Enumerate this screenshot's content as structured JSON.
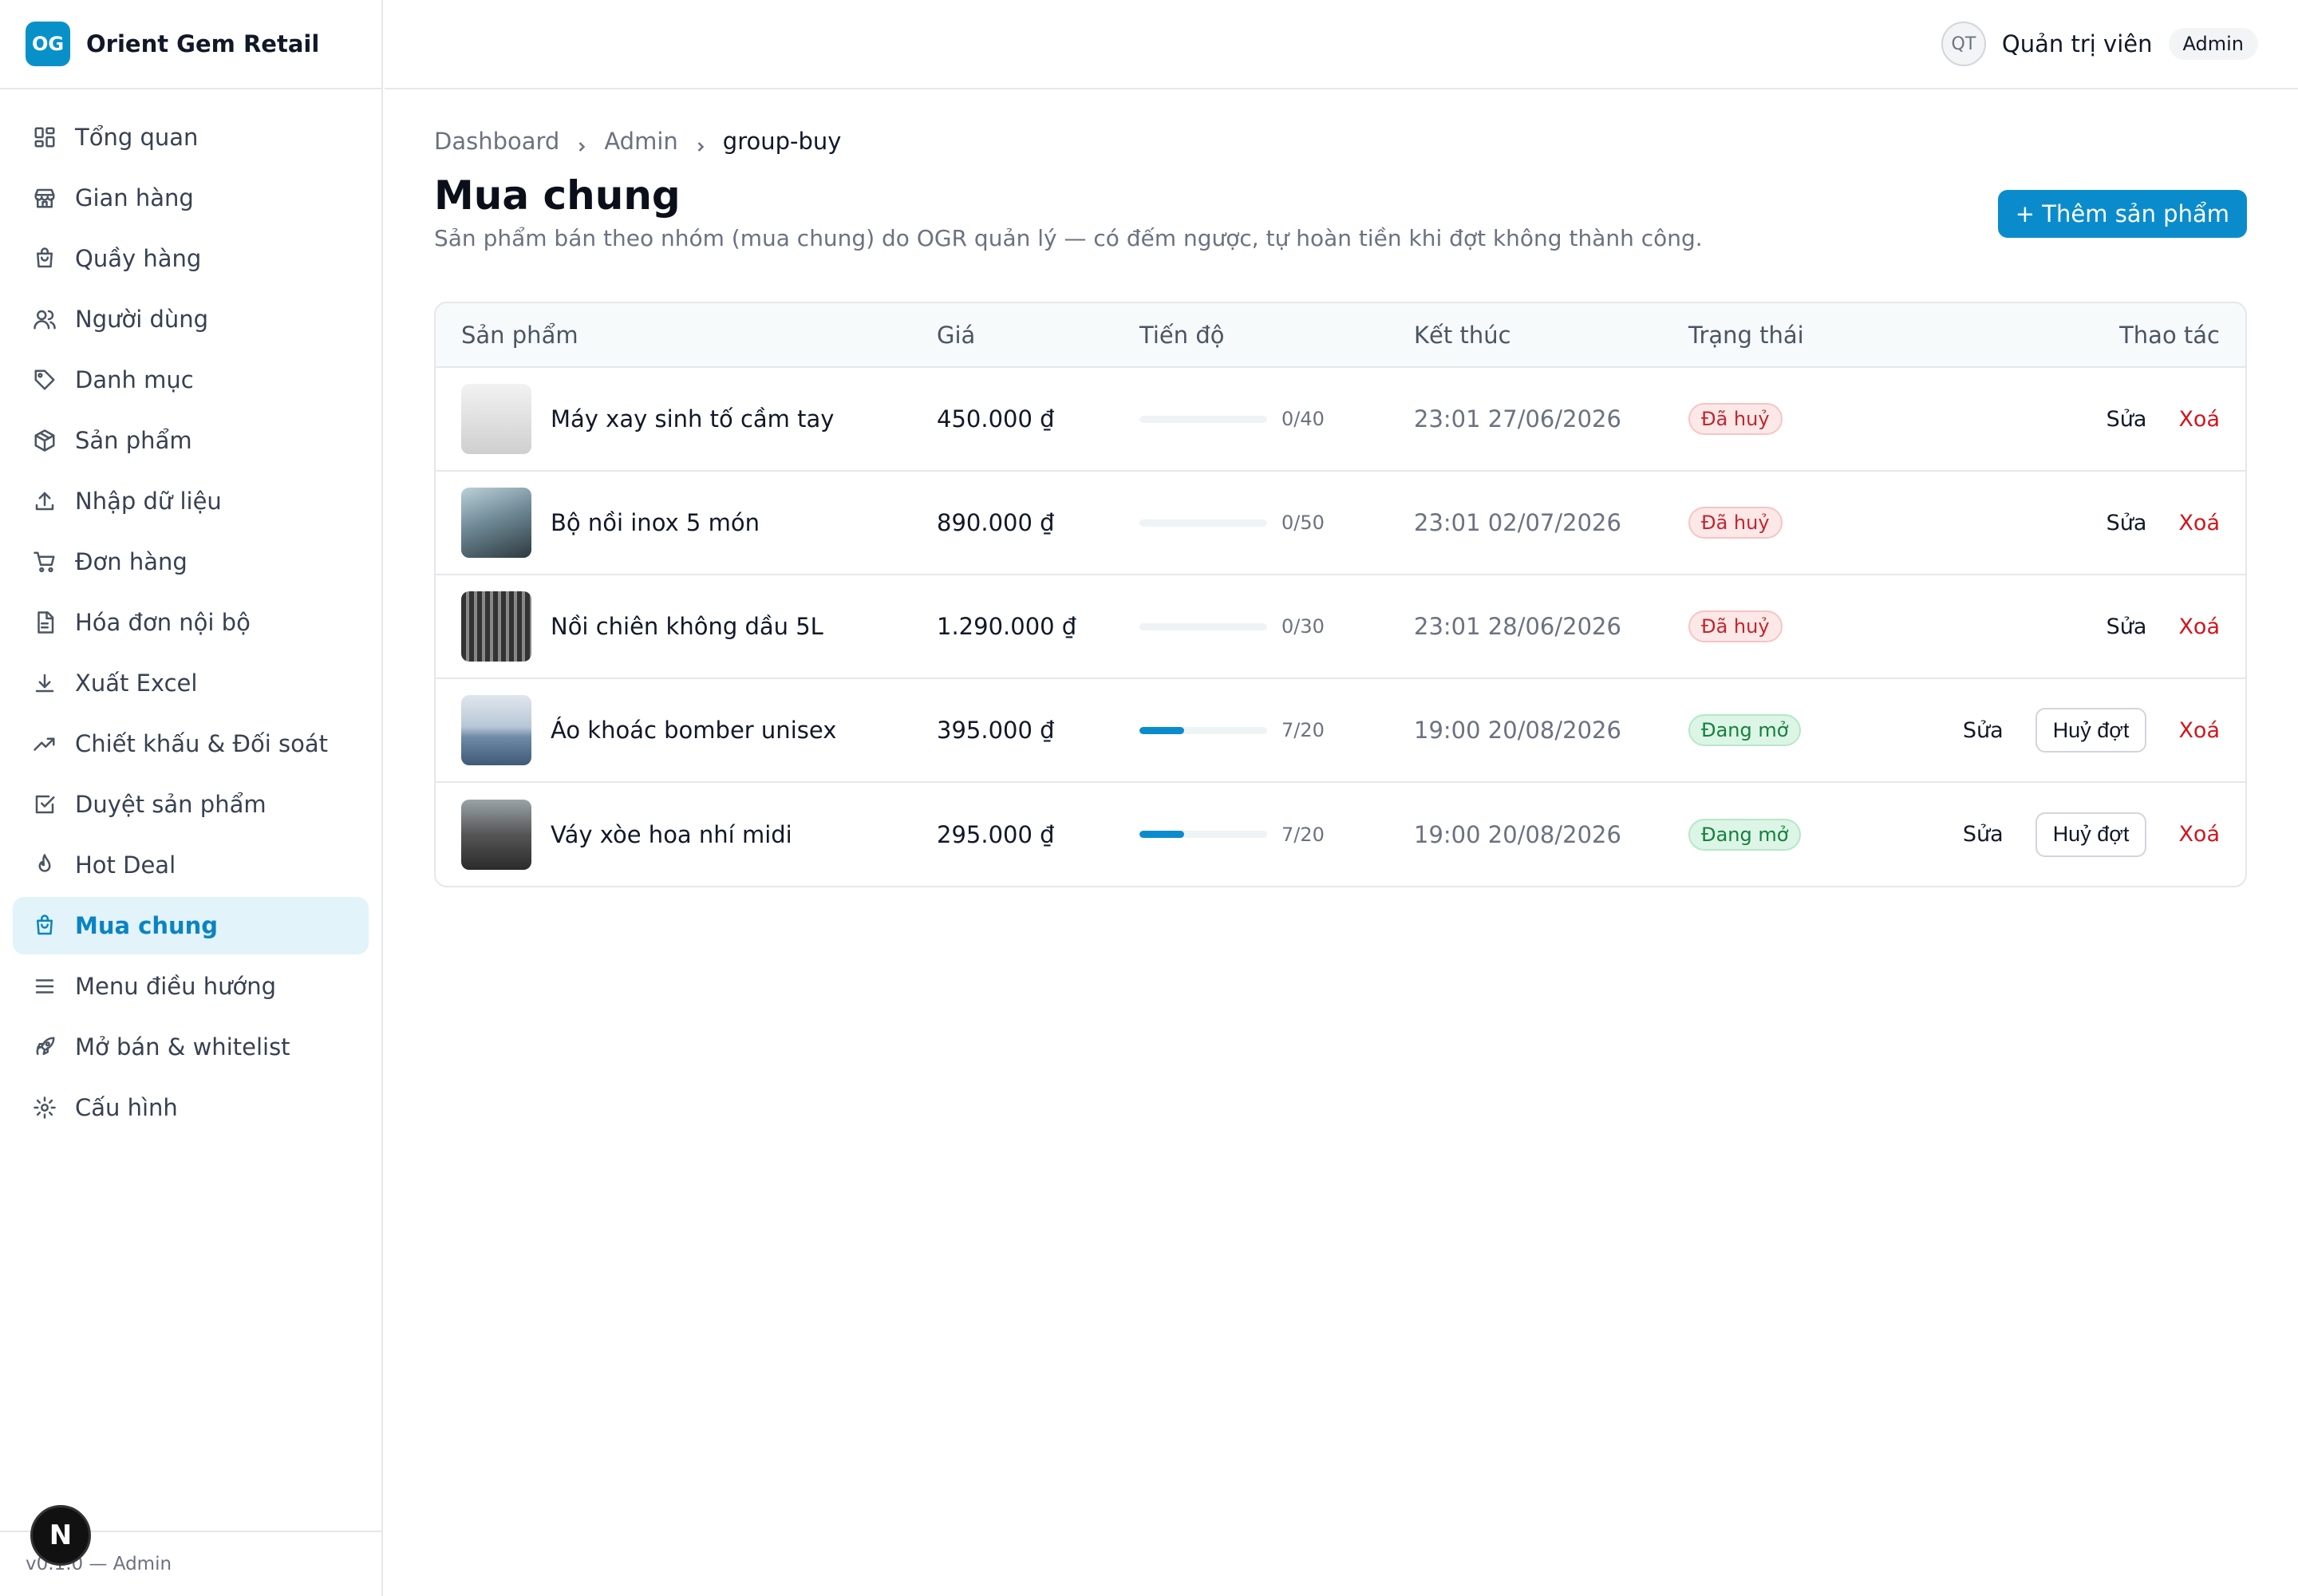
{
  "brand": {
    "logo": "OG",
    "name": "Orient Gem Retail"
  },
  "sidebar": {
    "items": [
      {
        "label": "Tổng quan",
        "icon": "dashboard-icon"
      },
      {
        "label": "Gian hàng",
        "icon": "store-icon"
      },
      {
        "label": "Quầy hàng",
        "icon": "bag-icon"
      },
      {
        "label": "Người dùng",
        "icon": "users-icon"
      },
      {
        "label": "Danh mục",
        "icon": "tag-icon"
      },
      {
        "label": "Sản phẩm",
        "icon": "package-icon"
      },
      {
        "label": "Nhập dữ liệu",
        "icon": "upload-icon"
      },
      {
        "label": "Đơn hàng",
        "icon": "cart-icon"
      },
      {
        "label": "Hóa đơn nội bộ",
        "icon": "file-icon"
      },
      {
        "label": "Xuất Excel",
        "icon": "download-icon"
      },
      {
        "label": "Chiết khấu & Đối soát",
        "icon": "trending-icon"
      },
      {
        "label": "Duyệt sản phẩm",
        "icon": "check-square-icon"
      },
      {
        "label": "Hot Deal",
        "icon": "flame-icon"
      },
      {
        "label": "Mua chung",
        "icon": "bag-icon",
        "active": true
      },
      {
        "label": "Menu điều hướng",
        "icon": "menu-icon"
      },
      {
        "label": "Mở bán & whitelist",
        "icon": "rocket-icon"
      },
      {
        "label": "Cấu hình",
        "icon": "gear-icon"
      }
    ],
    "footer": "v0.1.0 — Admin",
    "next_badge": "N"
  },
  "header": {
    "avatar": "QT",
    "user_name": "Quản trị viên",
    "role": "Admin"
  },
  "breadcrumb": [
    "Dashboard",
    "Admin",
    "group-buy"
  ],
  "page": {
    "title": "Mua chung",
    "description": "Sản phẩm bán theo nhóm (mua chung) do OGR quản lý — có đếm ngược, tự hoàn tiền khi đợt không thành công.",
    "add_button": "+ Thêm sản phẩm"
  },
  "table": {
    "columns": [
      "Sản phẩm",
      "Giá",
      "Tiến độ",
      "Kết thúc",
      "Trạng thái",
      "Thao tác"
    ],
    "rows": [
      {
        "name": "Máy xay sinh tố cầm tay",
        "price": "450.000 ₫",
        "progress_text": "0/40",
        "progress": 0.0,
        "end": "23:01 27/06/2026",
        "status": "Đã huỷ",
        "status_type": "cancel",
        "actions": [
          "Sửa",
          "Xoá"
        ]
      },
      {
        "name": "Bộ nồi inox 5 món",
        "price": "890.000 ₫",
        "progress_text": "0/50",
        "progress": 0.0,
        "end": "23:01 02/07/2026",
        "status": "Đã huỷ",
        "status_type": "cancel",
        "actions": [
          "Sửa",
          "Xoá"
        ]
      },
      {
        "name": "Nồi chiên không dầu 5L",
        "price": "1.290.000 ₫",
        "progress_text": "0/30",
        "progress": 0.0,
        "end": "23:01 28/06/2026",
        "status": "Đã huỷ",
        "status_type": "cancel",
        "actions": [
          "Sửa",
          "Xoá"
        ]
      },
      {
        "name": "Áo khoác bomber unisex",
        "price": "395.000 ₫",
        "progress_text": "7/20",
        "progress": 0.35,
        "end": "19:00 20/08/2026",
        "status": "Đang mở",
        "status_type": "open",
        "actions": [
          "Sửa",
          "Huỷ đợt",
          "Xoá"
        ]
      },
      {
        "name": "Váy xòe hoa nhí midi",
        "price": "295.000 ₫",
        "progress_text": "7/20",
        "progress": 0.35,
        "end": "19:00 20/08/2026",
        "status": "Đang mở",
        "status_type": "open",
        "actions": [
          "Sửa",
          "Huỷ đợt",
          "Xoá"
        ]
      }
    ]
  },
  "colors": {
    "accent": "#0a8ccc",
    "danger": "#d1151c",
    "success": "#15803d"
  }
}
